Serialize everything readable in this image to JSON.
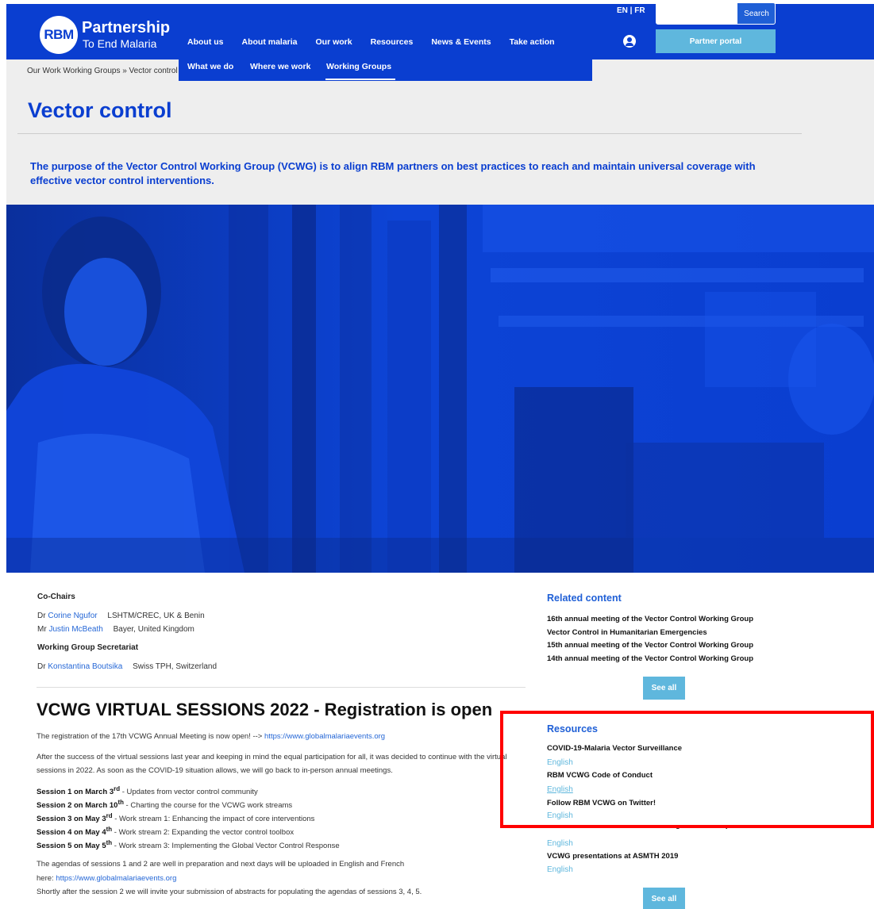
{
  "header": {
    "logo_mark": "RBM",
    "logo_title": "Partnership",
    "logo_subtitle": "To End Malaria",
    "nav": [
      "About us",
      "About malaria",
      "Our work",
      "Resources",
      "News & Events",
      "Take action"
    ],
    "lang": "EN | FR",
    "search_placeholder": "",
    "search_label": "Search",
    "partner_portal": "Partner portal"
  },
  "subnav": [
    "What we do",
    "Where we work",
    "Working Groups"
  ],
  "breadcrumb": "Our Work Working Groups » Vector control",
  "page_title": "Vector control",
  "intro": "The purpose of the Vector Control Working Group (VCWG) is to align RBM partners on best practices to reach and maintain universal coverage with effective vector control interventions.",
  "cochairs": {
    "label": "Co-Chairs",
    "people": [
      {
        "title": "Dr",
        "name": "Corine Ngufor",
        "org": "LSHTM/CREC, UK & Benin"
      },
      {
        "title": "Mr",
        "name": "Justin McBeath",
        "org": "Bayer, United Kingdom"
      }
    ]
  },
  "secretariat": {
    "label": "Working Group Secretariat",
    "people": [
      {
        "title": "Dr",
        "name": "Konstantina Boutsika",
        "org": "Swiss TPH, Switzerland"
      }
    ]
  },
  "sessions": {
    "title": "VCWG VIRTUAL SESSIONS 2022 - Registration is open",
    "registration_text": "The registration of the 17th VCWG Annual Meeting is now open!  -->",
    "registration_url": "https://www.globalmalariaevents.org",
    "para1": "After the success of the virtual sessions last year and keeping in mind the equal participation for all, it was decided to continue with the virtual sessions in 2022. As soon as the COVID-19 situation allows, we will go back to in-person annual meetings.",
    "list": [
      {
        "name": "Session 1 on March 3",
        "sup": "rd",
        "desc": " - Updates from vector control community"
      },
      {
        "name": "Session 2 on March 10",
        "sup": "th",
        "desc": " - Charting the course for the VCWG work streams"
      },
      {
        "name": "Session 3 on May 3",
        "sup": "rd",
        "desc": " - Work stream 1: Enhancing the impact of core interventions"
      },
      {
        "name": "Session 4 on May 4",
        "sup": "th",
        "desc": " -  Work stream 2: Expanding the vector control toolbox"
      },
      {
        "name": "Session 5 on May 5",
        "sup": "th",
        "desc": " - Work stream 3: Implementing the Global Vector Control Response"
      }
    ],
    "agenda_text": "The agendas of sessions 1 and 2 are well in preparation and next days will be uploaded in English and French",
    "agenda_here": "here:",
    "agenda_url": "https://www.globalmalariaevents.org",
    "abstracts_text": "Shortly after the session 2 we will invite your submission of abstracts for populating the agendas of sessions 3, 4, 5."
  },
  "related": {
    "heading": "Related content",
    "items": [
      "16th annual meeting of the Vector Control Working Group",
      "Vector Control in Humanitarian Emergencies",
      "15th annual meeting of the Vector Control Working Group",
      "14th annual meeting of the Vector Control Working Group"
    ],
    "see_all": "See all"
  },
  "resources": {
    "heading": "Resources",
    "items": [
      {
        "title": "COVID-19-Malaria Vector Surveillance",
        "lang": "English"
      },
      {
        "title": "RBM VCWG Code of Conduct",
        "lang": "English"
      },
      {
        "title": "Follow RBM VCWG on Twitter!",
        "lang": "English"
      },
      {
        "title": "RBM Vector Control in Human Emergencies 19 Sept 2019",
        "lang": "English"
      },
      {
        "title": "VCWG presentations at ASMTH 2019",
        "lang": "English"
      }
    ],
    "see_all": "See all"
  },
  "colors": {
    "brand_blue": "#0a3ed0",
    "accent_cyan": "#5fb7dd",
    "highlight": "#ff0000"
  }
}
